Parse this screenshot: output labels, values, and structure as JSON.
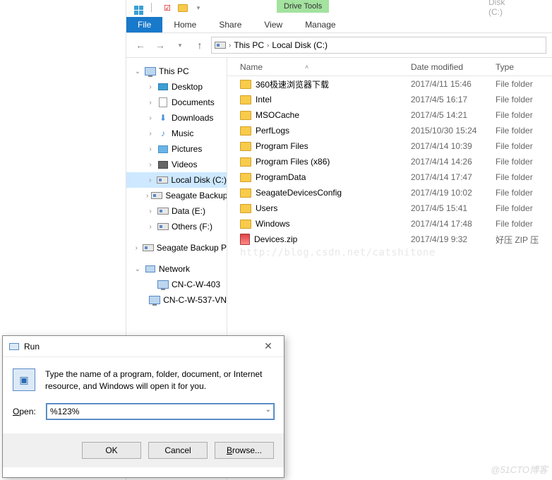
{
  "window_title": "Local Disk (C:)",
  "ribbon": {
    "context_group": "Drive Tools",
    "tabs": {
      "file": "File",
      "home": "Home",
      "share": "Share",
      "view": "View",
      "manage": "Manage"
    }
  },
  "breadcrumb": {
    "root": "This PC",
    "current": "Local Disk (C:)"
  },
  "nav_tree": {
    "this_pc": "This PC",
    "items": [
      {
        "icon": "desktop",
        "label": "Desktop"
      },
      {
        "icon": "documents",
        "label": "Documents"
      },
      {
        "icon": "downloads",
        "label": "Downloads"
      },
      {
        "icon": "music",
        "label": "Music"
      },
      {
        "icon": "pictures",
        "label": "Pictures"
      },
      {
        "icon": "videos",
        "label": "Videos"
      },
      {
        "icon": "disk",
        "label": "Local Disk (C:)",
        "selected": true
      },
      {
        "icon": "disk",
        "label": "Seagate Backup"
      },
      {
        "icon": "disk",
        "label": "Data (E:)"
      },
      {
        "icon": "disk",
        "label": "Others (F:)"
      }
    ],
    "seagate_root": "Seagate Backup P",
    "network": "Network",
    "network_items": [
      {
        "label": "CN-C-W-403"
      },
      {
        "label": "CN-C-W-537-VN"
      }
    ]
  },
  "columns": {
    "name": "Name",
    "date": "Date modified",
    "type": "Type"
  },
  "files": [
    {
      "icon": "folder",
      "name": "360极速浏览器下载",
      "date": "2017/4/11 15:46",
      "type": "File folder"
    },
    {
      "icon": "folder",
      "name": "Intel",
      "date": "2017/4/5 16:17",
      "type": "File folder"
    },
    {
      "icon": "folder",
      "name": "MSOCache",
      "date": "2017/4/5 14:21",
      "type": "File folder"
    },
    {
      "icon": "folder",
      "name": "PerfLogs",
      "date": "2015/10/30 15:24",
      "type": "File folder"
    },
    {
      "icon": "folder",
      "name": "Program Files",
      "date": "2017/4/14 10:39",
      "type": "File folder"
    },
    {
      "icon": "folder",
      "name": "Program Files (x86)",
      "date": "2017/4/14 14:26",
      "type": "File folder"
    },
    {
      "icon": "folder",
      "name": "ProgramData",
      "date": "2017/4/14 17:47",
      "type": "File folder"
    },
    {
      "icon": "folder",
      "name": "SeagateDevicesConfig",
      "date": "2017/4/19 10:02",
      "type": "File folder"
    },
    {
      "icon": "folder",
      "name": "Users",
      "date": "2017/4/5 15:41",
      "type": "File folder"
    },
    {
      "icon": "folder",
      "name": "Windows",
      "date": "2017/4/14 17:48",
      "type": "File folder"
    },
    {
      "icon": "zip",
      "name": "Devices.zip",
      "date": "2017/4/19 9:32",
      "type": "好压 ZIP 压"
    }
  ],
  "run_dialog": {
    "title": "Run",
    "description": "Type the name of a program, folder, document, or Internet resource, and Windows will open it for you.",
    "open_label": "Open:",
    "value": "%123%",
    "buttons": {
      "ok": "OK",
      "cancel": "Cancel",
      "browse": "Browse..."
    }
  },
  "watermark": "@51CTO博客",
  "blog_watermark": "http://blog.csdn.net/catshitone"
}
